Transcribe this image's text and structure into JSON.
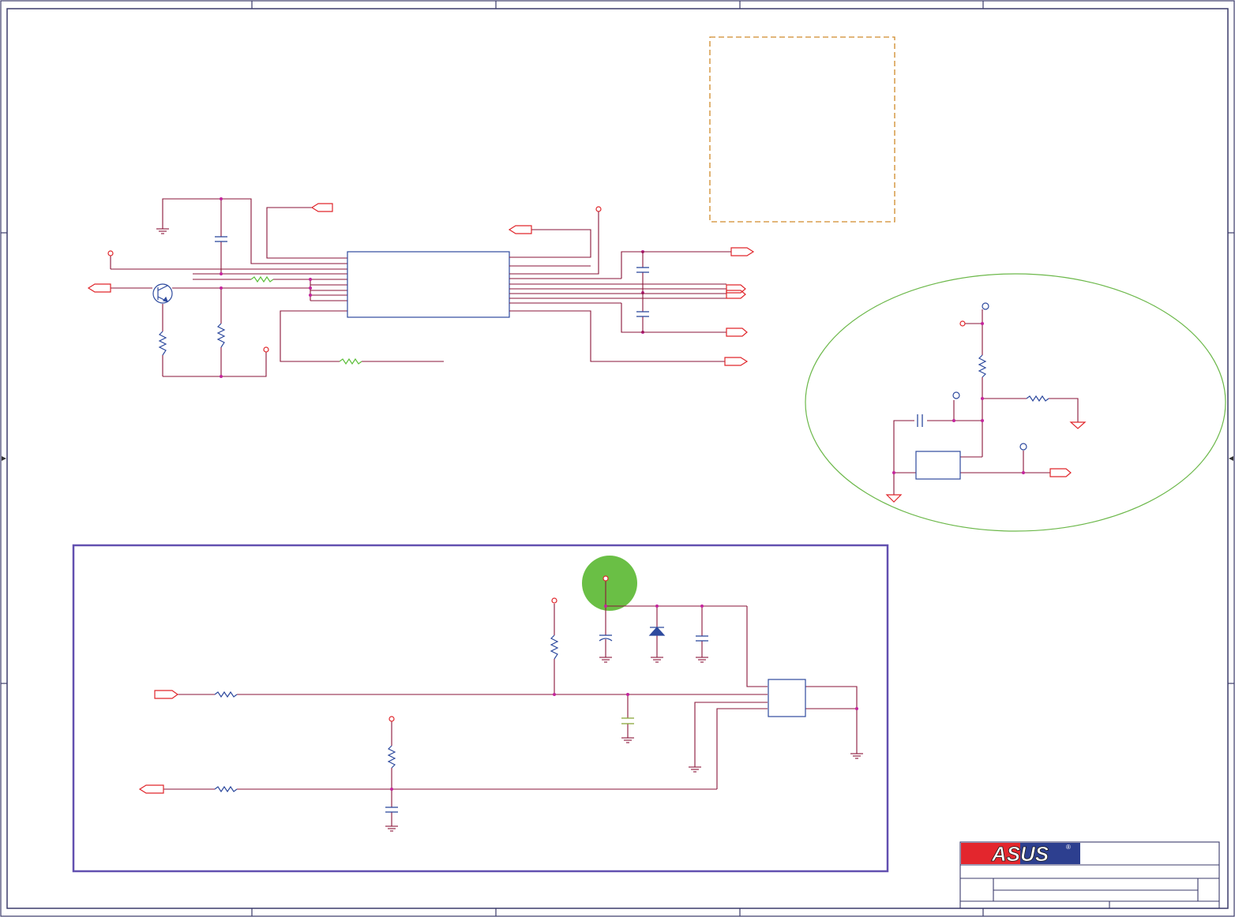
{
  "title_block": {
    "logo_text": "ASUS",
    "registered_mark": "®"
  },
  "colors": {
    "wire": "#8a1538",
    "pin_red": "#e0262b",
    "component_blue": "#2e4a9e",
    "junction_magenta": "#c4249c",
    "dashed_box": "#d08a2a",
    "ellipse_green": "#6cb84a",
    "highlight_green": "#6abf45",
    "section_border": "#6250b0",
    "resistor_green": "#5fbf3c",
    "capacitor_green": "#8aa83a",
    "logo_red": "#e3262d",
    "logo_blue": "#2d3f8f",
    "frame": "#3b3b6b"
  },
  "icons": {
    "transistor": "npn-transistor-icon",
    "diode": "diode-icon",
    "ground": "ground-icon",
    "resistor": "resistor-icon",
    "capacitor": "capacitor-icon",
    "port": "port-arrow-icon"
  }
}
